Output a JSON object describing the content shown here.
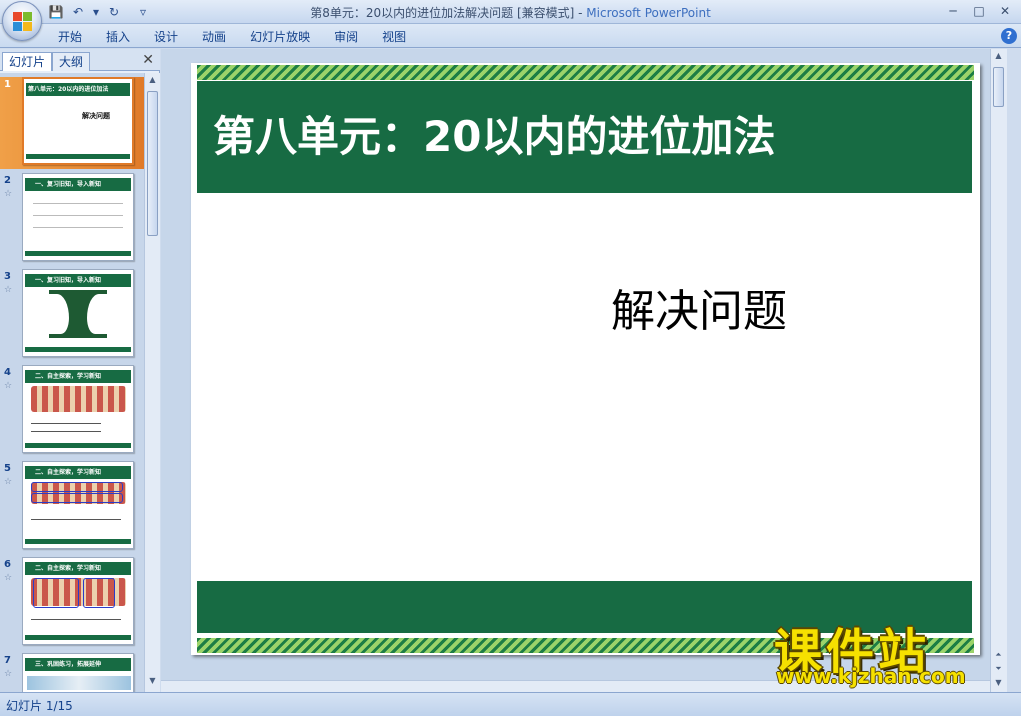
{
  "window": {
    "title": "第8单元：20以内的进位加法解决问题 [兼容模式]",
    "separator": " - ",
    "app_name": "Microsoft PowerPoint"
  },
  "qat": {
    "save_icon": "💾",
    "undo_icon": "↶",
    "dropdown_icon": "▾",
    "redo_icon": "↻",
    "customize_icon": "▿"
  },
  "window_controls": {
    "minimize": "─",
    "maximize": "□",
    "close": "✕"
  },
  "ribbon": {
    "tabs": [
      "开始",
      "插入",
      "设计",
      "动画",
      "幻灯片放映",
      "审阅",
      "视图"
    ],
    "help": "?"
  },
  "left_pane": {
    "tab_slides": "幻灯片",
    "tab_outline": "大纲",
    "close": "✕",
    "thumbnails": [
      {
        "num": "1",
        "header": "第八单元：20以内的进位加法",
        "sub": "解决问题",
        "selected": true
      },
      {
        "num": "2",
        "star": "☆",
        "header": "一、复习旧知，导入新知"
      },
      {
        "num": "3",
        "star": "☆",
        "header": "一、复习旧知，导入新知"
      },
      {
        "num": "4",
        "star": "☆",
        "header": "二、自主探索，学习新知"
      },
      {
        "num": "5",
        "star": "☆",
        "header": "二、自主探索，学习新知"
      },
      {
        "num": "6",
        "star": "☆",
        "header": "二、自主探索，学习新知"
      },
      {
        "num": "7",
        "star": "☆",
        "header": "三、巩固练习，拓展延伸"
      }
    ]
  },
  "slide": {
    "title": "第八单元：20以内的进位加法",
    "subtitle": "解决问题"
  },
  "watermark": {
    "title": "课件站",
    "url": "www.kjzhan.com"
  },
  "status": {
    "slide_indicator": "幻灯片 1/15"
  },
  "colors": {
    "slide_green": "#176b43",
    "watermark_yellow": "#f6e100",
    "selection_orange": "#e07a28"
  }
}
